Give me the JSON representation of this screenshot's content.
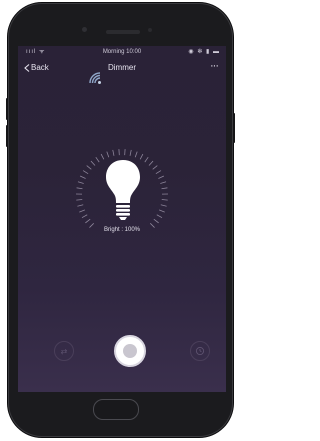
{
  "status_bar": {
    "signal": "ıııl ᯤ",
    "time": "Morning 10:00",
    "indicators": "◉ ✻ ▮ ▬"
  },
  "nav": {
    "back_label": "Back",
    "title": "Dimmer",
    "more_label": "···"
  },
  "lamp": {
    "brightness_text": "Bright : 100%",
    "brightness_level": 1.0
  },
  "controls": {
    "mode_icon": "⇄"
  },
  "colors": {
    "screen_top": "#2a2237",
    "screen_bottom": "#3a2f4c",
    "accent": "#ffffff"
  },
  "icons": [
    "back-chevron-icon",
    "wifi-signal-icon",
    "more-icon",
    "bulb-icon",
    "mode-icon",
    "power-icon",
    "timer-icon"
  ]
}
